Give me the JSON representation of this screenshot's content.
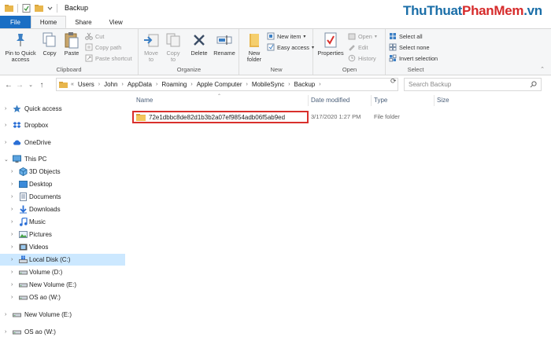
{
  "window": {
    "title": "Backup",
    "watermark_part1": "ThuThuat",
    "watermark_part2": "PhanMem",
    "watermark_part3": ".vn"
  },
  "tabs": [
    "File",
    "Home",
    "Share",
    "View"
  ],
  "ribbon": {
    "clipboard": {
      "label": "Clipboard",
      "pin": "Pin to Quick access",
      "copy": "Copy",
      "paste": "Paste",
      "cut": "Cut",
      "copy_path": "Copy path",
      "paste_shortcut": "Paste shortcut"
    },
    "organize": {
      "label": "Organize",
      "move_to": "Move to",
      "copy_to": "Copy to",
      "delete": "Delete",
      "rename": "Rename"
    },
    "new": {
      "label": "New",
      "new_folder": "New folder",
      "new_item": "New item",
      "easy_access": "Easy access"
    },
    "open": {
      "label": "Open",
      "properties": "Properties",
      "open": "Open",
      "edit": "Edit",
      "history": "History"
    },
    "select": {
      "label": "Select",
      "select_all": "Select all",
      "select_none": "Select none",
      "invert_selection": "Invert selection"
    }
  },
  "address": {
    "prefix": "«",
    "crumbs": [
      "Users",
      "John",
      "AppData",
      "Roaming",
      "Apple Computer",
      "MobileSync",
      "Backup"
    ],
    "search_placeholder": "Search Backup"
  },
  "nav": {
    "items": [
      {
        "label": "Quick access"
      },
      {
        "label": "Dropbox"
      },
      {
        "label": "OneDrive"
      },
      {
        "label": "This PC"
      },
      {
        "label": "3D Objects"
      },
      {
        "label": "Desktop"
      },
      {
        "label": "Documents"
      },
      {
        "label": "Downloads"
      },
      {
        "label": "Music"
      },
      {
        "label": "Pictures"
      },
      {
        "label": "Videos"
      },
      {
        "label": "Local Disk (C:)"
      },
      {
        "label": "Volume (D:)"
      },
      {
        "label": "New Volume (E:)"
      },
      {
        "label": "OS ao (W:)"
      },
      {
        "label": "New Volume (E:)"
      },
      {
        "label": "OS ao (W:)"
      }
    ]
  },
  "columns": {
    "name": "Name",
    "date_modified": "Date modified",
    "type": "Type",
    "size": "Size"
  },
  "files": [
    {
      "name": "72e1dbbc8de82d1b3b2a07ef9854adb06f5ab9ed",
      "date_modified": "3/17/2020 1:27 PM",
      "type": "File folder",
      "size": ""
    }
  ],
  "colors": {
    "file_tab": "#1a6ec4",
    "selected_nav": "#cce8ff",
    "highlight_box": "#d9302c",
    "folder": "#e8b64c"
  }
}
